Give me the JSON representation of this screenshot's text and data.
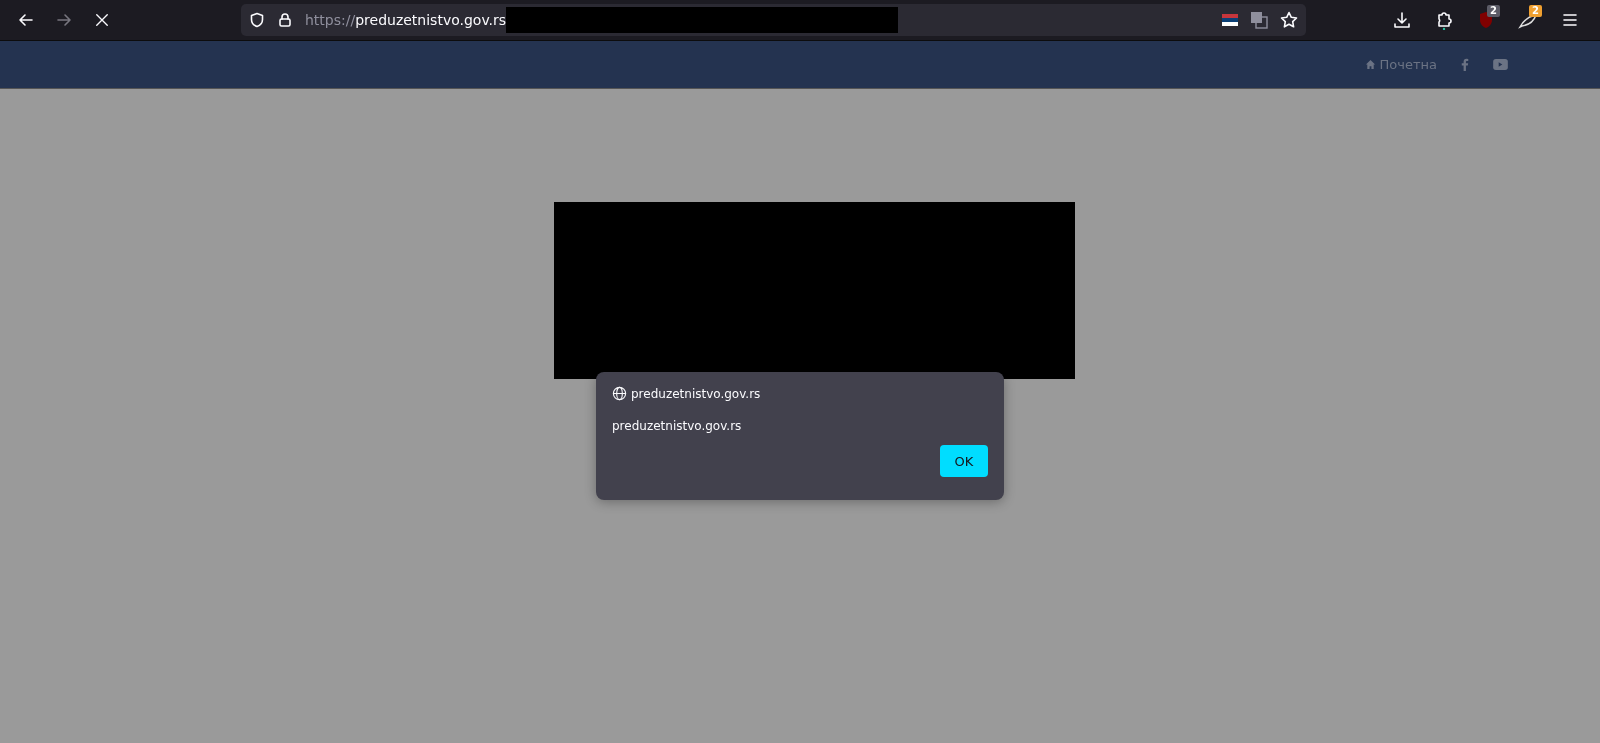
{
  "browser": {
    "url_scheme": "https://",
    "url_host": "preduzetnistvo.gov.rs",
    "extension_badges": [
      {
        "count": "2",
        "color": "#5b5b66"
      },
      {
        "count": "2",
        "color": "#f0a030"
      }
    ]
  },
  "site_header": {
    "home_link": "Почетна"
  },
  "dialog": {
    "origin": "preduzetnistvo.gov.rs",
    "message": "preduzetnistvo.gov.rs",
    "button": "OK"
  }
}
